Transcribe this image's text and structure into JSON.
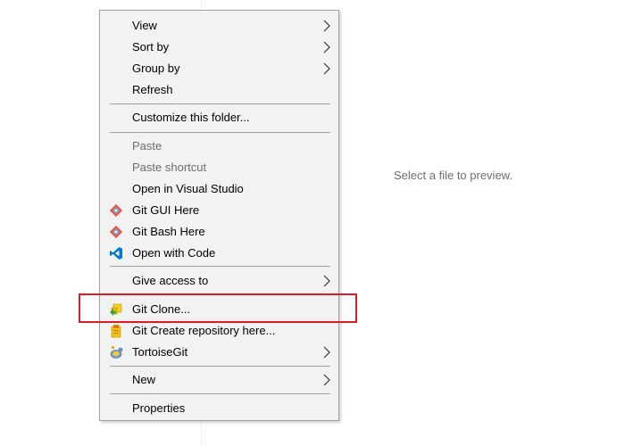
{
  "preview": {
    "text": "Select a file to preview."
  },
  "context_menu": {
    "items": [
      {
        "label": "View",
        "has_submenu": true,
        "enabled": true
      },
      {
        "label": "Sort by",
        "has_submenu": true,
        "enabled": true
      },
      {
        "label": "Group by",
        "has_submenu": true,
        "enabled": true
      },
      {
        "label": "Refresh",
        "has_submenu": false,
        "enabled": true
      },
      {
        "label": "Customize this folder...",
        "has_submenu": false,
        "enabled": true
      },
      {
        "label": "Paste",
        "has_submenu": false,
        "enabled": false
      },
      {
        "label": "Paste shortcut",
        "has_submenu": false,
        "enabled": false
      },
      {
        "label": "Open in Visual Studio",
        "has_submenu": false,
        "enabled": true
      },
      {
        "label": "Git GUI Here",
        "icon": "git-gui-icon",
        "has_submenu": false,
        "enabled": true
      },
      {
        "label": "Git Bash Here",
        "icon": "git-bash-icon",
        "has_submenu": false,
        "enabled": true
      },
      {
        "label": "Open with Code",
        "icon": "vscode-icon",
        "has_submenu": false,
        "enabled": true
      },
      {
        "label": "Give access to",
        "has_submenu": true,
        "enabled": true
      },
      {
        "label": "Git Clone...",
        "icon": "tortoisegit-clone-icon",
        "has_submenu": false,
        "enabled": true,
        "highlighted": true
      },
      {
        "label": "Git Create repository here...",
        "icon": "tortoisegit-create-repo-icon",
        "has_submenu": false,
        "enabled": true
      },
      {
        "label": "TortoiseGit",
        "icon": "tortoisegit-icon",
        "has_submenu": true,
        "enabled": true
      },
      {
        "label": "New",
        "has_submenu": true,
        "enabled": true
      },
      {
        "label": "Properties",
        "has_submenu": false,
        "enabled": true
      }
    ]
  },
  "colors": {
    "menu_background": "#f2f2f2",
    "menu_border": "#a0a0a0",
    "disabled_text": "#6d6d6d",
    "highlight_border": "#e01b24",
    "vscode_blue": "#0078d4",
    "git_orange": "#f05033"
  }
}
